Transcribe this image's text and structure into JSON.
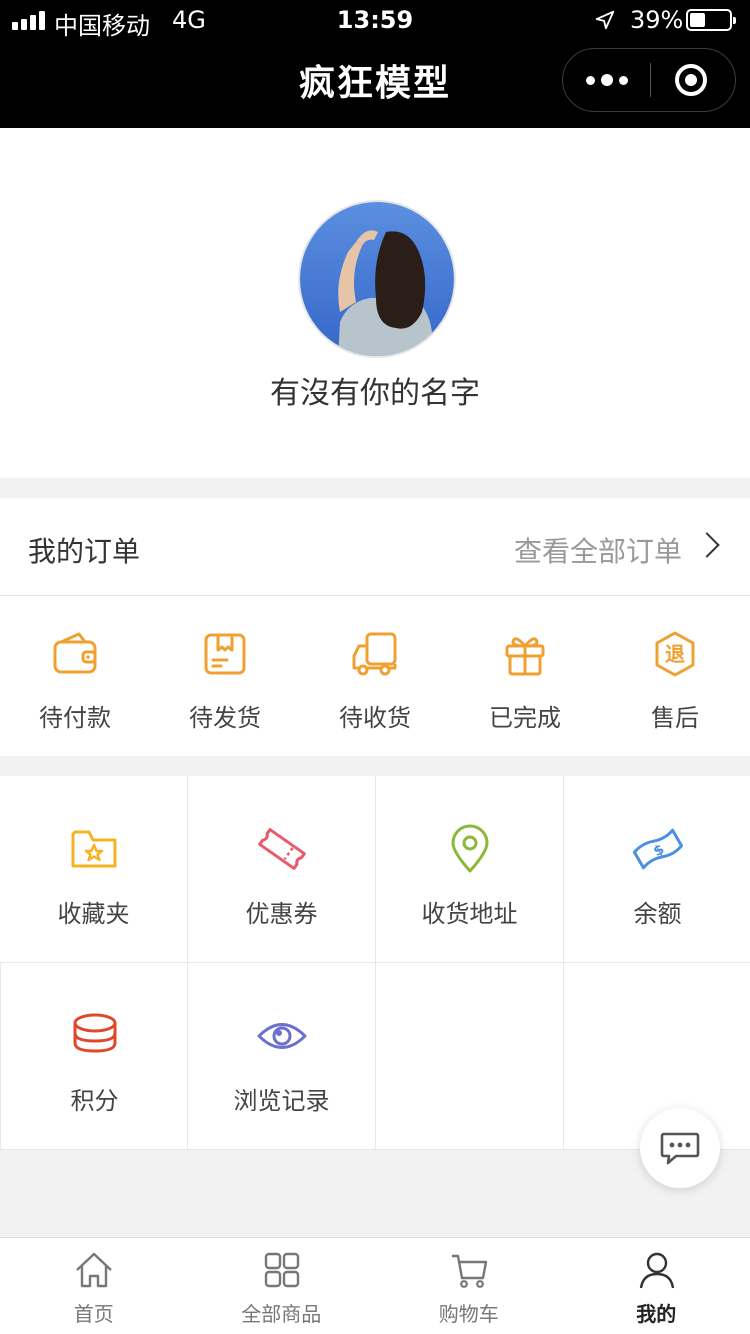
{
  "status_bar": {
    "carrier": "中国移动",
    "network": "4G",
    "time": "13:59",
    "battery_percent": "39%",
    "battery_level": 0.39
  },
  "nav": {
    "title": "疯狂模型"
  },
  "profile": {
    "username": "有沒有你的名字"
  },
  "orders": {
    "title": "我的订单",
    "view_all": "查看全部订单",
    "items": [
      {
        "label": "待付款",
        "icon": "wallet-icon"
      },
      {
        "label": "待发货",
        "icon": "package-icon"
      },
      {
        "label": "待收货",
        "icon": "truck-icon"
      },
      {
        "label": "已完成",
        "icon": "gift-icon"
      },
      {
        "label": "售后",
        "icon": "refund-icon",
        "badge": "退"
      }
    ],
    "accent": "#f0a030"
  },
  "services": {
    "items": [
      {
        "label": "收藏夹",
        "icon": "favorite-folder-icon",
        "color": "#f5b324"
      },
      {
        "label": "优惠券",
        "icon": "coupon-icon",
        "color": "#e85a6a"
      },
      {
        "label": "收货地址",
        "icon": "location-pin-icon",
        "color": "#8cb83a"
      },
      {
        "label": "余额",
        "icon": "balance-bill-icon",
        "color": "#4a90e2"
      },
      {
        "label": "积分",
        "icon": "coins-icon",
        "color": "#e0482a"
      },
      {
        "label": "浏览记录",
        "icon": "eye-icon",
        "color": "#6a6fd0"
      }
    ]
  },
  "tabbar": {
    "items": [
      {
        "label": "首页",
        "icon": "home-icon",
        "active": false
      },
      {
        "label": "全部商品",
        "icon": "grid-icon",
        "active": false
      },
      {
        "label": "购物车",
        "icon": "cart-icon",
        "active": false
      },
      {
        "label": "我的",
        "icon": "person-icon",
        "active": true
      }
    ]
  }
}
